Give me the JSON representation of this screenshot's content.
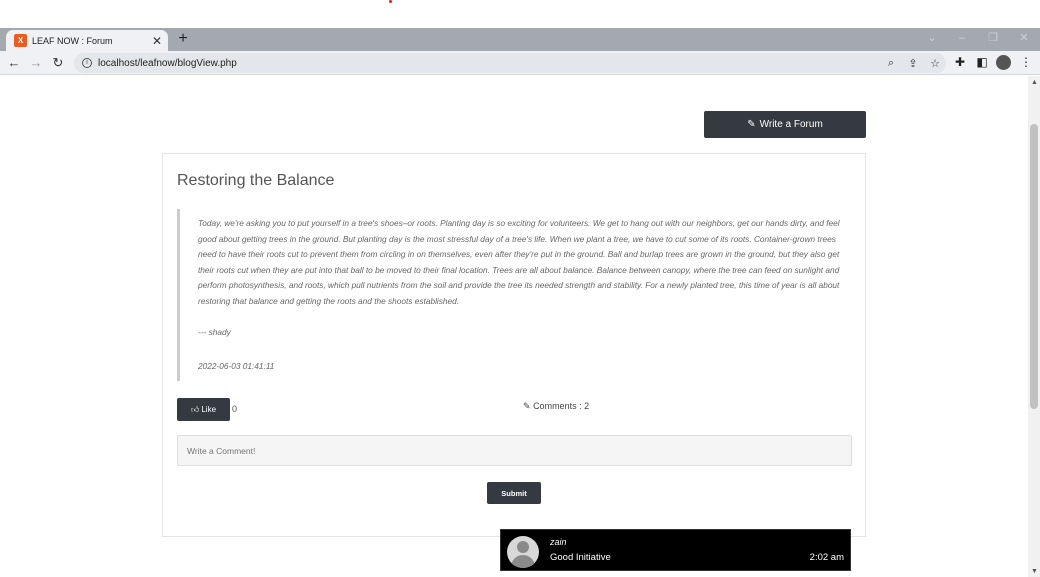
{
  "browser": {
    "tab_title": "LEAF NOW : Forum",
    "favicon_letter": "X",
    "url": "localhost/leafnow/blogView.php"
  },
  "page": {
    "write_forum_label": "Write a Forum",
    "post": {
      "title": "Restoring the Balance",
      "body": "Today, we're asking you to put yourself in a tree's shoes–or roots. Planting day is so exciting for volunteers. We get to hang out with our neighbors, get our hands dirty, and feel good about getting trees in the ground. But planting day is the most stressful day of a tree's life. When we plant a tree, we have to cut some of its roots. Container-grown trees need to have their roots cut to prevent them from circling in on themselves, even after they're put in the ground. Ball and burlap trees are grown in the ground, but they also get their roots cut when they are put into that ball to be moved to their final location. Trees are all about balance. Balance between canopy, where the tree can feed on sunlight and perform photosynthesis, and roots, which pull nutrients from the soil and provide the tree its needed strength and stability. For a newly planted tree, this time of year is all about restoring that balance and getting the roots and the shoots established.",
      "author": "--- shady",
      "date": "2022-06-03 01:41:11"
    },
    "like_label": "Like",
    "like_count": "0",
    "comments_label": "Comments : 2",
    "comment_placeholder": "Write a Comment!",
    "submit_label": "Submit",
    "comment": {
      "name": "zain",
      "text": "Good Initiative",
      "time": "2:02 am"
    }
  }
}
